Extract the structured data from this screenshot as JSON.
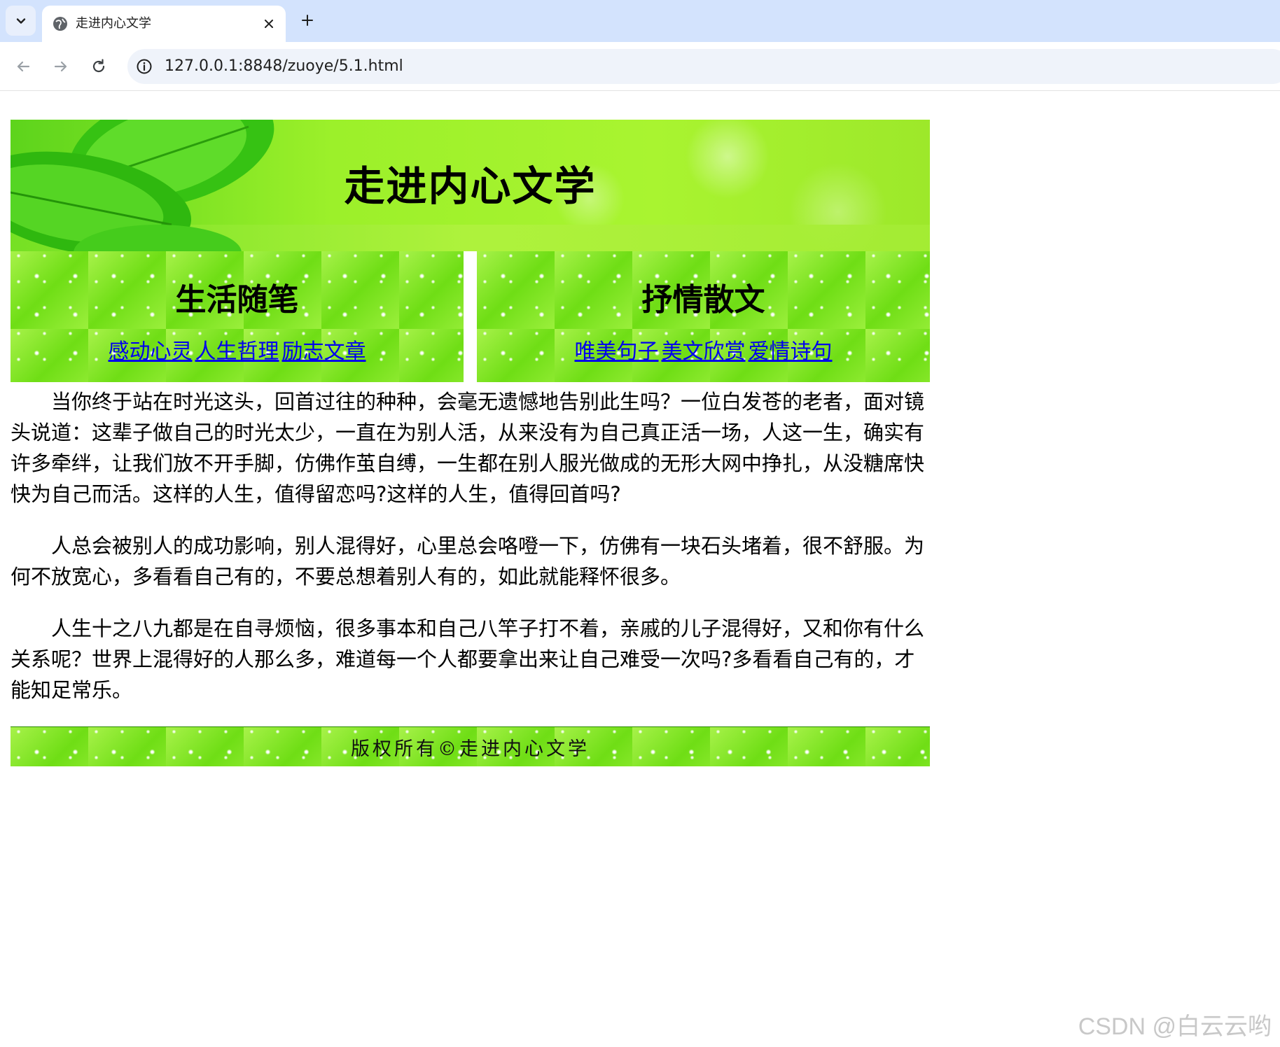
{
  "browser": {
    "tab_title": "走进内心文学",
    "url": "127.0.0.1:8848/zuoye/5.1.html",
    "icons": {
      "tab_dropdown": "chevron-down-icon",
      "favicon": "globe-icon",
      "close": "close-icon",
      "new_tab": "plus-icon",
      "back": "arrow-left-icon",
      "forward": "arrow-right-icon",
      "reload": "reload-icon",
      "site_info": "info-icon"
    }
  },
  "page": {
    "banner_title": "走进内心文学",
    "columns": [
      {
        "title": "生活随笔",
        "links": [
          "感动心灵",
          "人生哲理",
          "励志文章"
        ]
      },
      {
        "title": "抒情散文",
        "links": [
          "唯美句子",
          "美文欣赏",
          "爱情诗句"
        ]
      }
    ],
    "paragraphs": [
      "当你终于站在时光这头，回首过往的种种，会毫无遗憾地告别此生吗？一位白发苍的老者，面对镜头说道：这辈子做自己的时光太少，一直在为别人活，从来没有为自己真正活一场，人这一生，确实有许多牵绊，让我们放不开手脚，仿佛作茧自缚，一生都在别人服光做成的无形大网中挣扎，从没糖席快快为自己而活。这样的人生，值得留恋吗?这样的人生，值得回首吗?",
      "人总会被别人的成功影响，别人混得好，心里总会咯噔一下，仿佛有一块石头堵着，很不舒服。为何不放宽心，多看看自己有的，不要总想着别人有的，如此就能释怀很多。",
      "人生十之八九都是在自寻烦恼，很多事本和自己八竿子打不着，亲戚的儿子混得好，又和你有什么关系呢？世界上混得好的人那么多，难道每一个人都要拿出来让自己难受一次吗?多看看自己有的，才能知足常乐。"
    ],
    "footer": "版权所有©走进内心文学",
    "link_color": "#0000ee",
    "theme_green": "#7ee51e"
  },
  "watermark": "CSDN @白云云哟"
}
